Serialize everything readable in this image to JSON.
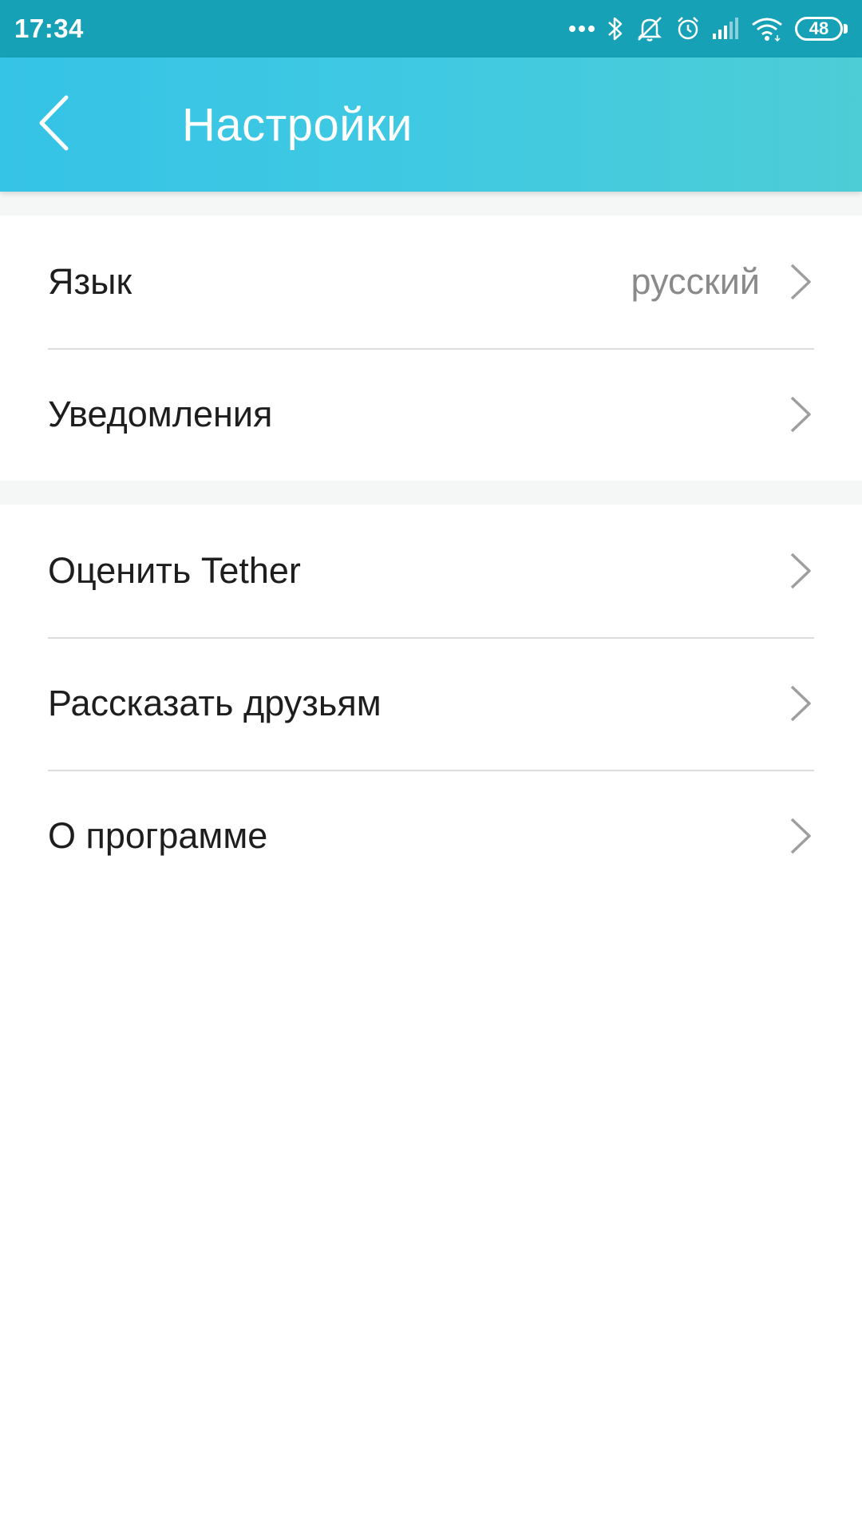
{
  "status_bar": {
    "time": "17:34",
    "battery_level": "48",
    "icons": [
      "more-dots-icon",
      "bluetooth-icon",
      "silent-icon",
      "alarm-icon",
      "signal-icon",
      "wifi-icon",
      "battery-icon"
    ]
  },
  "app_bar": {
    "title": "Настройки",
    "back_icon": "chevron-left-icon"
  },
  "colors": {
    "status_bar": "#16a1b7",
    "app_bar_start": "#35c3e6",
    "app_bar_end": "#4dcdd6",
    "section_gap": "#f5f6f6",
    "label_text": "#1e1e1e",
    "value_text": "#8a8a8a",
    "chevron": "#9e9e9e"
  },
  "sections": [
    {
      "items": [
        {
          "label": "Язык",
          "value": "русский"
        },
        {
          "label": "Уведомления"
        }
      ]
    },
    {
      "items": [
        {
          "label": "Оценить Tether"
        },
        {
          "label": "Рассказать друзьям"
        },
        {
          "label": "О программе"
        }
      ]
    }
  ]
}
